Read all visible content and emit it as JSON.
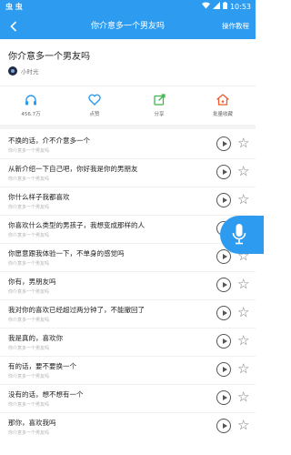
{
  "status_bar": {
    "left_text": "虫 虫",
    "time": "10:53",
    "icons": [
      "wifi-icon",
      "signal-icon",
      "battery-icon"
    ]
  },
  "top_bar": {
    "back_icon": "chevron-left-icon",
    "title": "你介意多一个男友吗",
    "tutorial": "操作教程"
  },
  "header": {
    "song_title": "你介意多一个男友吗",
    "author": "小时光"
  },
  "actions": [
    {
      "icon": "headphones-icon",
      "label": "456.7万",
      "color": "#2d9cf0"
    },
    {
      "icon": "heart-icon",
      "label": "点赞",
      "color": "#2d9cf0"
    },
    {
      "icon": "share-icon",
      "label": "分享",
      "color": "#3cb84a"
    },
    {
      "icon": "collect-icon",
      "label": "批量收藏",
      "color": "#f05a2a"
    }
  ],
  "list": [
    {
      "title": "不换的话，介不介意多一个",
      "subtitle": "你介意多一个男友吗"
    },
    {
      "title": "从新介绍一下自己吧，你好我是你的男朋友",
      "subtitle": "你介意多一个男友吗"
    },
    {
      "title": "你什么样子我都喜欢",
      "subtitle": "你介意多一个男友吗"
    },
    {
      "title": "你喜欢什么类型的男孩子，我想变成那样的人",
      "subtitle": "你介意多一个男友吗"
    },
    {
      "title": "你愿意跟我体验一下，不单身的感觉吗",
      "subtitle": "你介意多一个男友吗"
    },
    {
      "title": "你有，男朋友吗",
      "subtitle": "你介意多一个男友吗"
    },
    {
      "title": "我对你的喜欢已经超过两分钟了，不能撤回了",
      "subtitle": "你介意多一个男友吗"
    },
    {
      "title": "我是真的，喜欢你",
      "subtitle": "你介意多一个男友吗"
    },
    {
      "title": "有的话，要不要换一个",
      "subtitle": "你介意多一个男友吗"
    },
    {
      "title": "没有的话，想不想有一个",
      "subtitle": "你介意多一个男友吗"
    },
    {
      "title": "那你，喜欢我吗",
      "subtitle": "你介意多一个男友吗"
    }
  ],
  "mic_fab": {
    "icon": "microphone-icon"
  },
  "colors": {
    "accent": "#2d9cf0"
  }
}
